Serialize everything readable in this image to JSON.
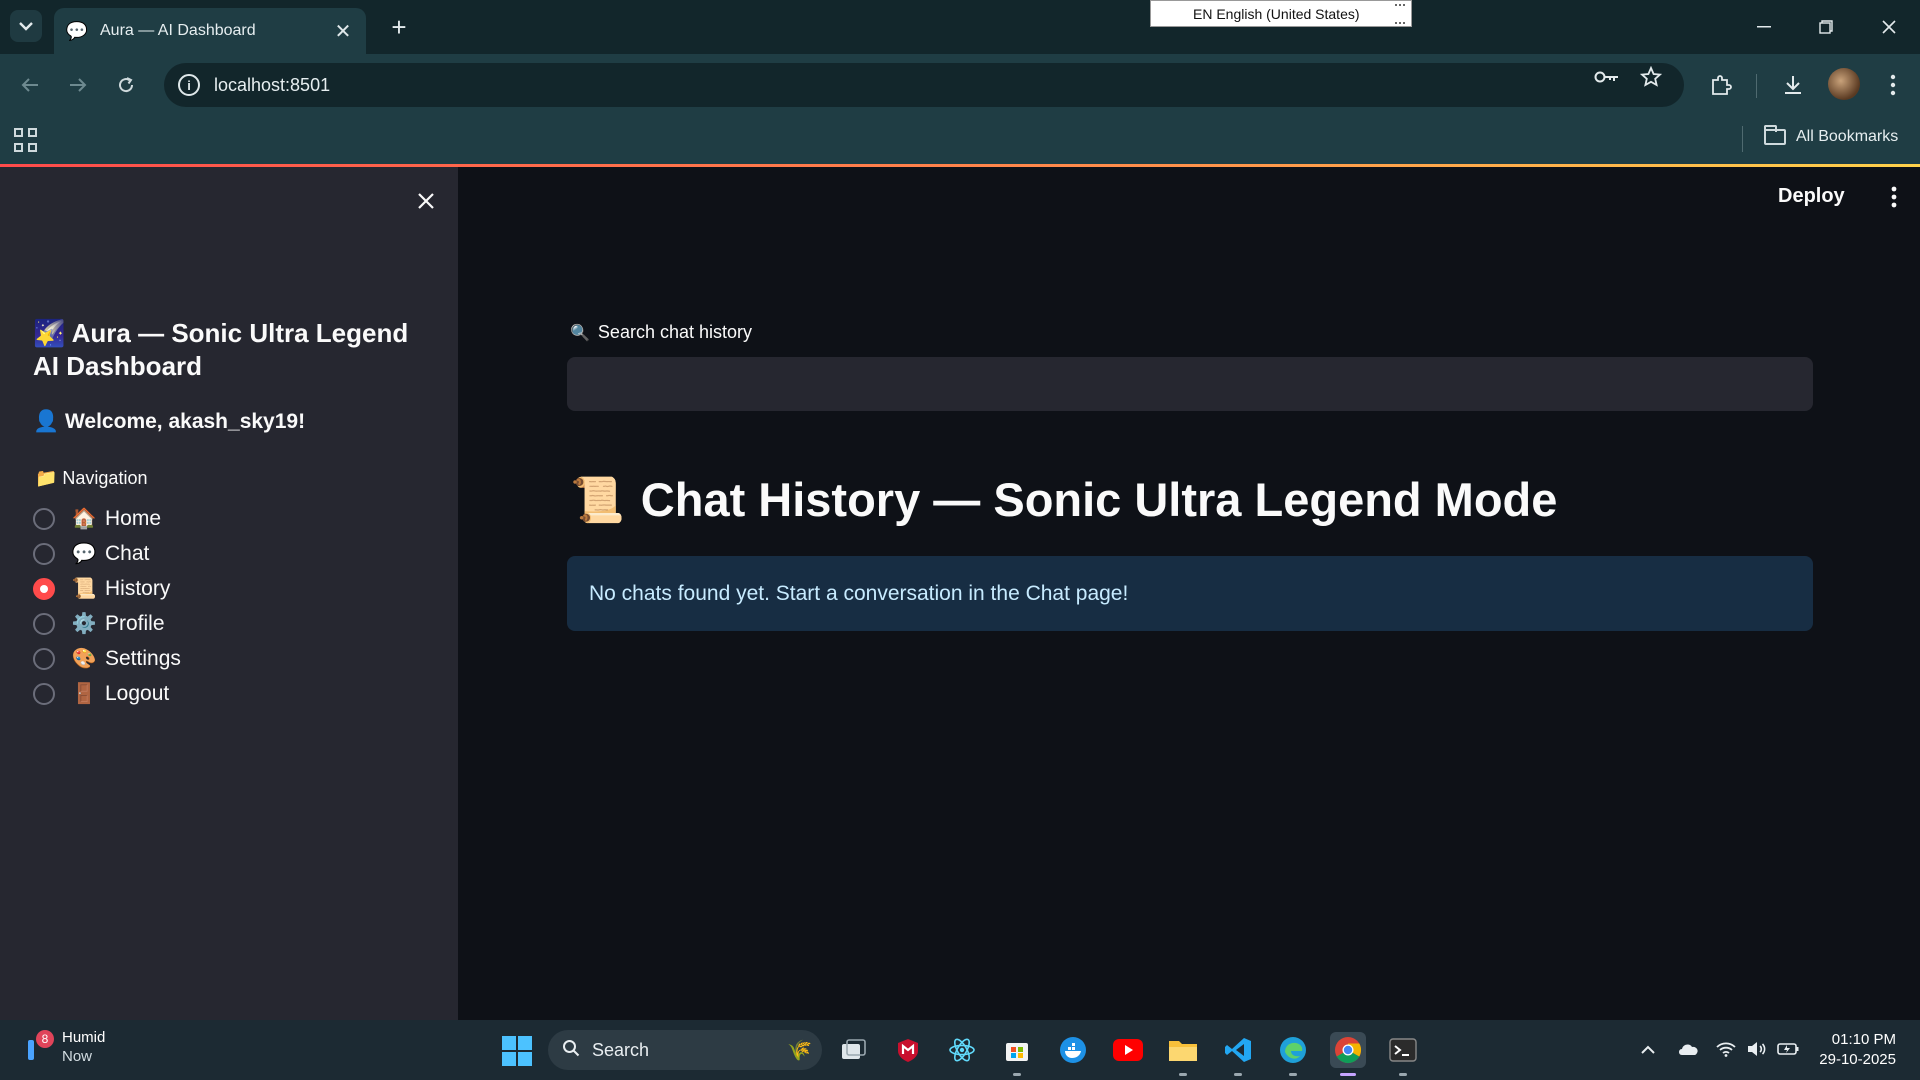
{
  "browser": {
    "tab_title": "Aura — AI Dashboard",
    "url": "localhost:8501",
    "language_popup": "EN English (United States)",
    "bookmarks_label": "All Bookmarks"
  },
  "app": {
    "deploy_label": "Deploy",
    "sidebar": {
      "title": "🌠 Aura — Sonic Ultra Legend AI Dashboard",
      "welcome": "👤 Welcome, akash_sky19!",
      "nav_label": "📁 Navigation",
      "nav_items": [
        {
          "emoji": "🏠",
          "label": "Home",
          "selected": false
        },
        {
          "emoji": "💬",
          "label": "Chat",
          "selected": false
        },
        {
          "emoji": "📜",
          "label": "History",
          "selected": true
        },
        {
          "emoji": "⚙️",
          "label": "Profile",
          "selected": false
        },
        {
          "emoji": "🎨",
          "label": "Settings",
          "selected": false
        },
        {
          "emoji": "🚪",
          "label": "Logout",
          "selected": false
        }
      ]
    },
    "main": {
      "search_label": "Search chat history",
      "search_value": "",
      "page_title": "Chat History — Sonic Ultra Legend Mode",
      "info_message": "No chats found yet. Start a conversation in the Chat page!"
    }
  },
  "taskbar": {
    "weather_label": "Humid",
    "weather_sub": "Now",
    "weather_badge": "8",
    "search_placeholder": "Search",
    "time": "01:10 PM",
    "date": "29-10-2025"
  },
  "colors": {
    "accent": "#ff4b4b",
    "sidebar_bg": "#262730",
    "main_bg": "#0e1117",
    "info_bg": "#172d43",
    "chrome_bg": "#1f3d44"
  }
}
